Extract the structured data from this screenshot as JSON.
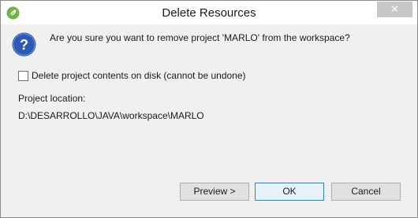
{
  "window": {
    "title": "Delete Resources",
    "close_glyph": "✕"
  },
  "dialog": {
    "question": "Are you sure you want to remove project 'MARLO' from the workspace?",
    "checkbox_label": "Delete project contents on disk (cannot be undone)",
    "checkbox_checked": false,
    "location_label": "Project location:",
    "location_path": "D:\\DESARROLLO\\JAVA\\workspace\\MARLO"
  },
  "buttons": {
    "preview": "Preview >",
    "ok": "OK",
    "cancel": "Cancel"
  },
  "colors": {
    "question_icon": "#2d5bb3",
    "spring_icon": "#6db33f"
  }
}
